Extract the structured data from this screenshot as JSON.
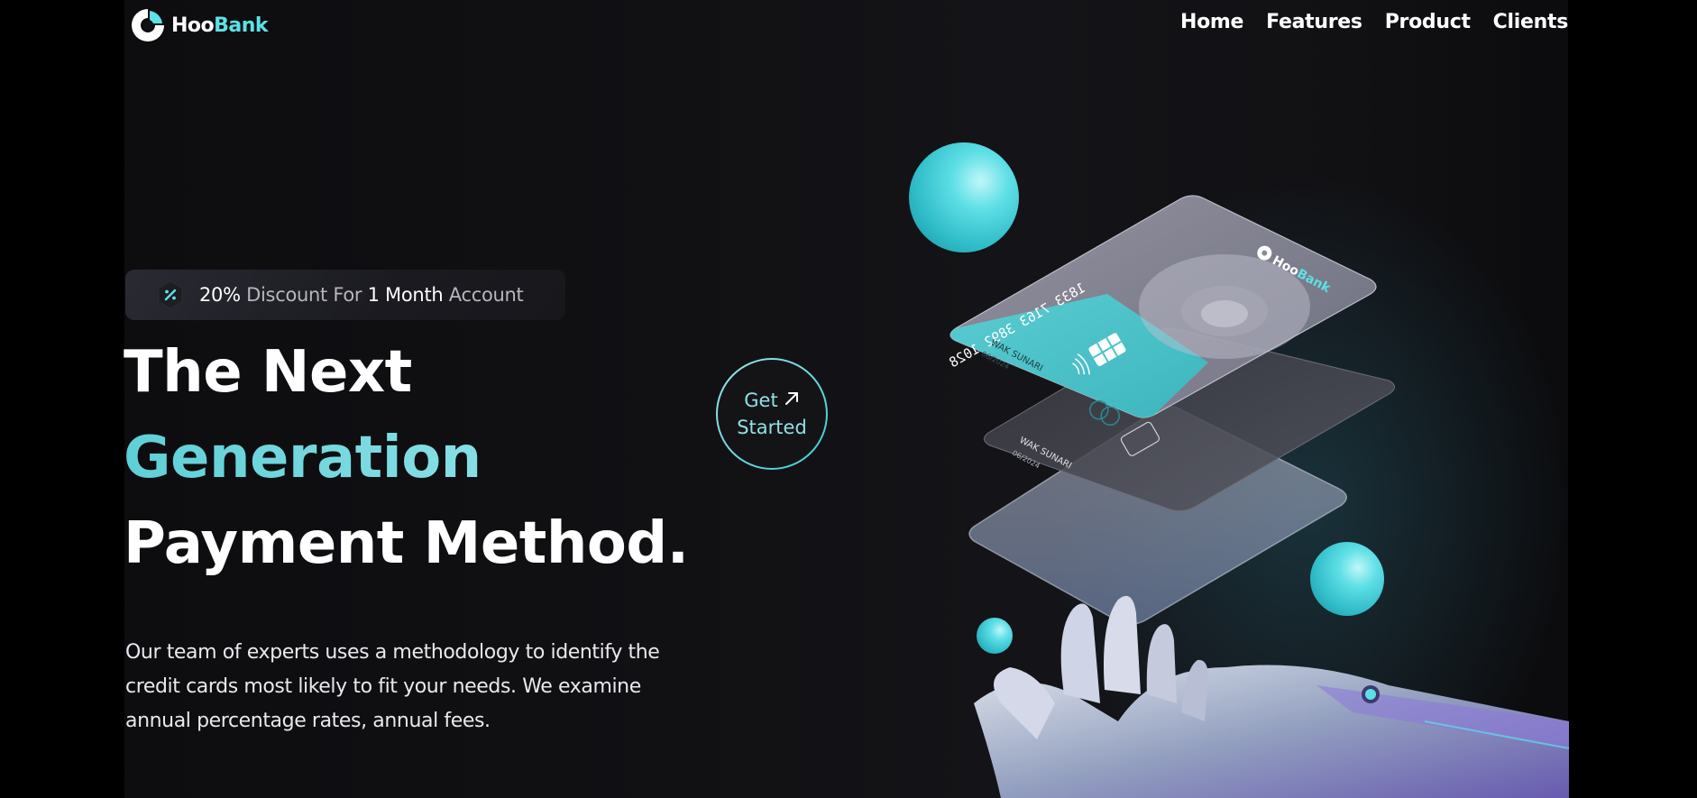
{
  "navbar": {
    "logo": {
      "part1": "Hoo",
      "part2": "Bank"
    },
    "links": [
      {
        "label": "Home"
      },
      {
        "label": "Features"
      },
      {
        "label": "Product"
      },
      {
        "label": "Clients"
      }
    ]
  },
  "hero": {
    "badge": {
      "percent": "20%",
      "discount": " Discount For ",
      "duration": "1 Month",
      "account": " Account"
    },
    "headline": {
      "line1": "The Next",
      "line2": "Generation",
      "line3": "Payment Method."
    },
    "description": "Our team of experts uses a methodology to identify the credit cards most likely to fit your needs. We examine annual percentage rates, annual fees.",
    "cta": {
      "line1": "Get",
      "line2": "Started"
    }
  },
  "cards": {
    "number": "1833 7163 3892 1028",
    "holder": "WAK SUNARI",
    "expiry": "06/2024",
    "brand_part1": "Hoo",
    "brand_part2": "Bank"
  },
  "colors": {
    "accent": "#5ce1e6",
    "background": "#0f0f12",
    "text": "#ffffff"
  }
}
